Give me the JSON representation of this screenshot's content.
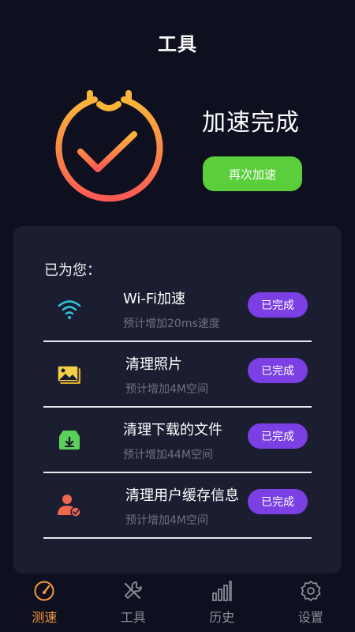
{
  "header": {
    "title": "工具"
  },
  "hero": {
    "status": "加速完成",
    "button_label": "再次加速",
    "ring_colors": {
      "top": "#f9b53a",
      "bottom": "#fb5a54"
    }
  },
  "card": {
    "heading": "已为您：",
    "items": [
      {
        "title": "Wi-Fi加速",
        "subtitle": "预计增加20ms速度",
        "badge": "已完成",
        "icon": "wifi-icon"
      },
      {
        "title": "清理照片",
        "subtitle": "预计增加4M空间",
        "badge": "已完成",
        "icon": "photo-icon"
      },
      {
        "title": "清理下载的文件",
        "subtitle": "预计增加44M空间",
        "badge": "已完成",
        "icon": "download-box-icon"
      },
      {
        "title": "清理用户缓存信息",
        "subtitle": "预计增加4M空间",
        "badge": "已完成",
        "icon": "user-cache-icon"
      }
    ]
  },
  "nav": {
    "items": [
      {
        "label": "测速",
        "icon": "speedometer-icon",
        "active": true
      },
      {
        "label": "工具",
        "icon": "tools-icon",
        "active": false
      },
      {
        "label": "历史",
        "icon": "bar-chart-icon",
        "active": false
      },
      {
        "label": "设置",
        "icon": "gear-icon",
        "active": false
      }
    ]
  },
  "colors": {
    "background": "#0e0f1f",
    "card": "#1b1d31",
    "accent_green": "#5bce3b",
    "badge_purple": "#7b3fe4",
    "nav_active": "#f59a3c"
  }
}
